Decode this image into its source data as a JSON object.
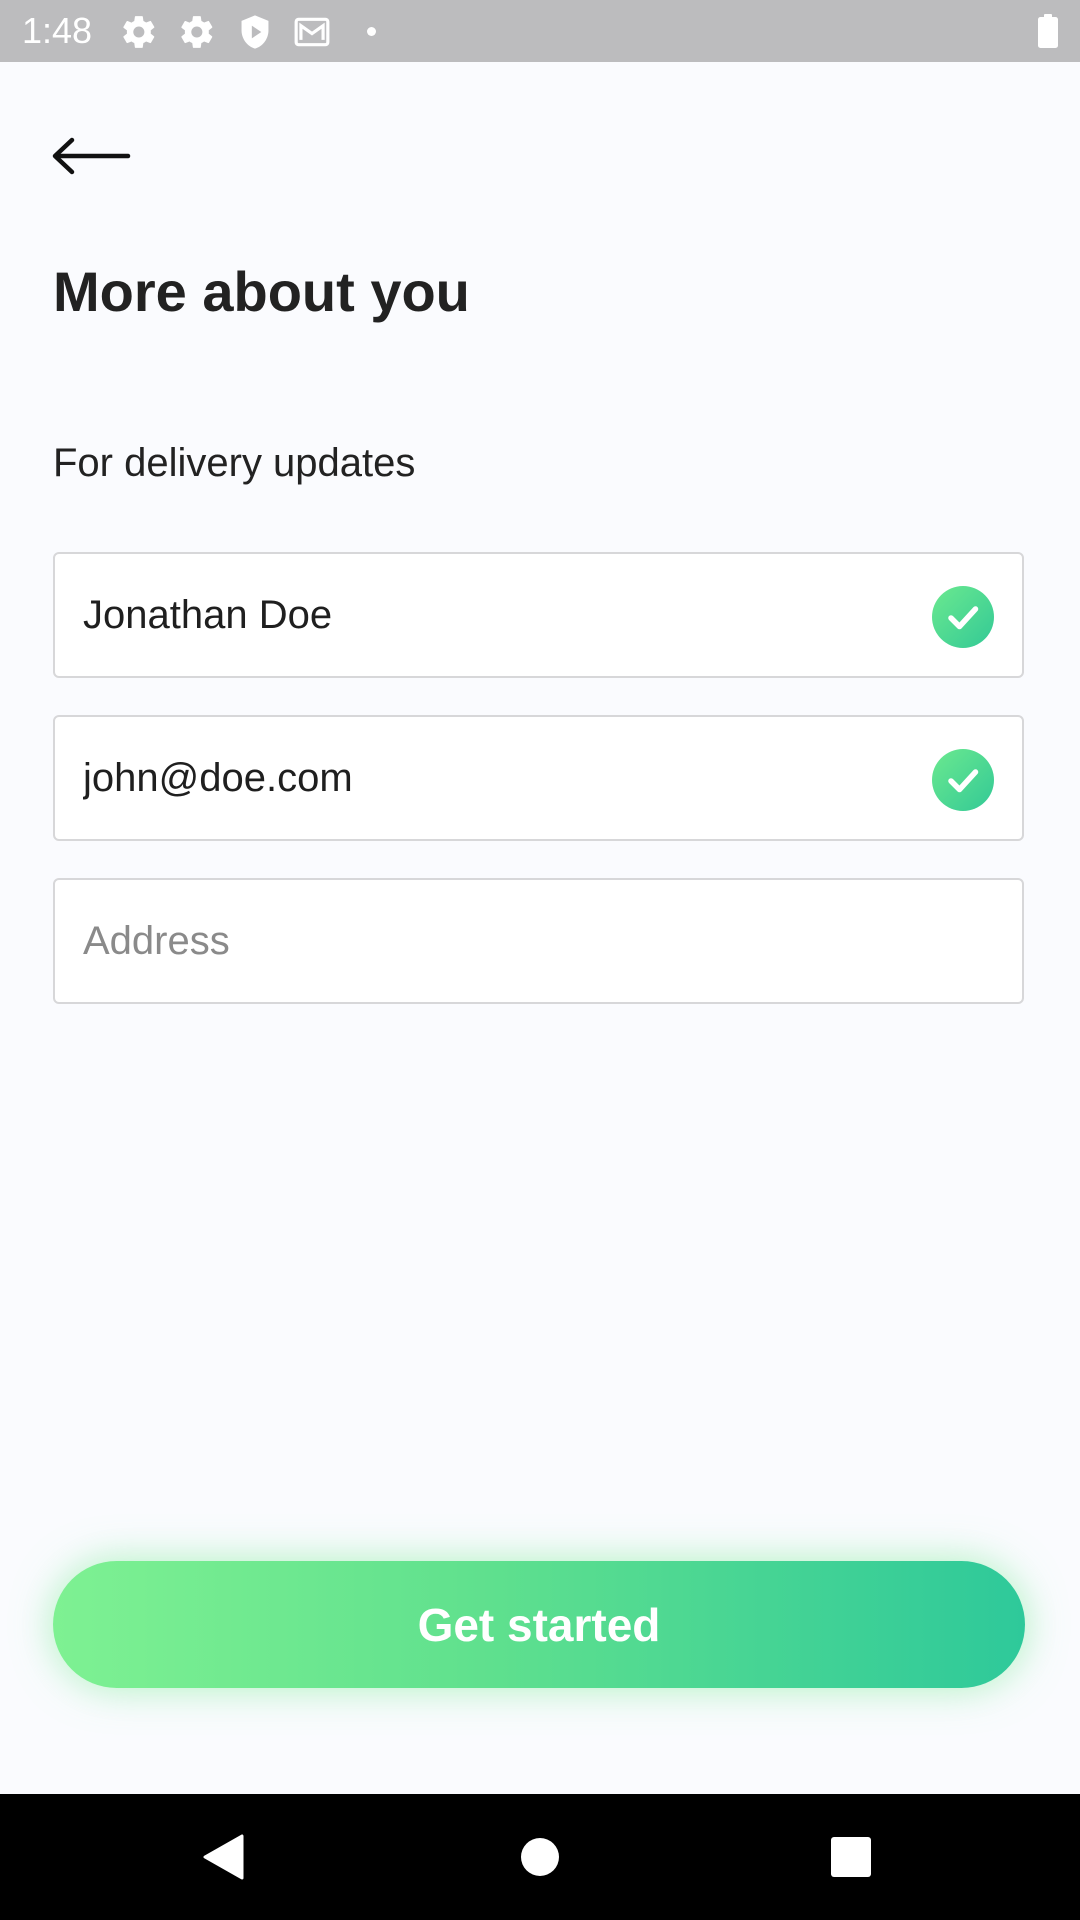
{
  "status_bar": {
    "time": "1:48",
    "icons": [
      "gear-icon",
      "gear-icon",
      "shield-play-icon",
      "mail-icon",
      "dot-icon",
      "battery-icon"
    ]
  },
  "header": {
    "back_icon": "arrow-left-icon",
    "title": "More about you"
  },
  "form": {
    "subtitle": "For delivery updates",
    "name_value": "Jonathan Doe",
    "email_value": "john@doe.com",
    "address_value": "",
    "address_placeholder": "Address",
    "valid_icon": "check-circle-icon"
  },
  "cta": {
    "label": "Get started"
  },
  "colors": {
    "background": "#fafbfe",
    "status_bar": "#bcbcbe",
    "accent_start": "#7ef192",
    "accent_end": "#2ec99a",
    "check": "#4fd98f"
  },
  "nav_bar": {
    "icons": [
      "back-triangle-icon",
      "home-circle-icon",
      "recents-square-icon"
    ]
  }
}
